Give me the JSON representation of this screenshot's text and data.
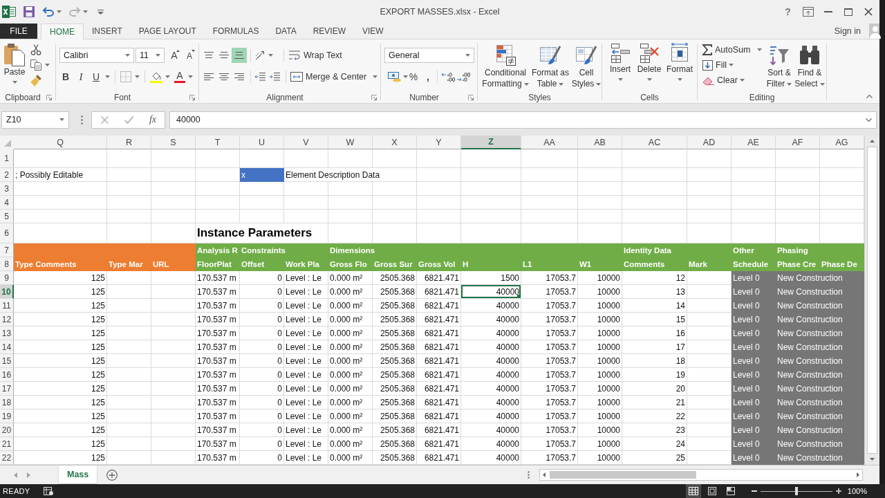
{
  "window": {
    "title": "EXPORT MASSES.xlsx - Excel",
    "help": "?",
    "account": "Sign in"
  },
  "ribbon_tabs": [
    {
      "label": "FILE",
      "kind": "file",
      "selected": false
    },
    {
      "label": "HOME",
      "kind": "tab",
      "selected": true
    },
    {
      "label": "INSERT",
      "kind": "tab",
      "selected": false
    },
    {
      "label": "PAGE LAYOUT",
      "kind": "tab",
      "selected": false
    },
    {
      "label": "FORMULAS",
      "kind": "tab",
      "selected": false
    },
    {
      "label": "DATA",
      "kind": "tab",
      "selected": false
    },
    {
      "label": "REVIEW",
      "kind": "tab",
      "selected": false
    },
    {
      "label": "VIEW",
      "kind": "tab",
      "selected": false
    }
  ],
  "ribbon": {
    "clipboard": {
      "label": "Clipboard",
      "paste": "Paste"
    },
    "font": {
      "label": "Font",
      "name": "Calibri",
      "size": "11",
      "grow": "A",
      "shrink": "A",
      "bold": "B",
      "italic": "I",
      "underline": "U",
      "font_color": "A"
    },
    "alignment": {
      "label": "Alignment",
      "vertical": [
        {
          "kind": "top",
          "selected": false
        },
        {
          "kind": "middle",
          "selected": false
        },
        {
          "kind": "bottom",
          "selected": true
        }
      ],
      "wrap_text": "Wrap Text",
      "merge": "Merge & Center"
    },
    "number": {
      "label": "Number",
      "format": "General",
      "percent": "%",
      "comma": ","
    },
    "styles": {
      "label": "Styles",
      "buttons": [
        {
          "kind": "conditional",
          "label": "Conditional Formatting"
        },
        {
          "kind": "table",
          "label": "Format as Table"
        },
        {
          "kind": "cell_styles",
          "label": "Cell Styles"
        }
      ]
    },
    "cells": {
      "label": "Cells",
      "buttons": [
        {
          "kind": "insert",
          "label": "Insert"
        },
        {
          "kind": "delete",
          "label": "Delete"
        },
        {
          "kind": "format",
          "label": "Format"
        }
      ]
    },
    "editing": {
      "label": "Editing",
      "small": [
        {
          "kind": "autosum",
          "label": "AutoSum"
        },
        {
          "kind": "fill",
          "label": "Fill"
        },
        {
          "kind": "clear",
          "label": "Clear"
        }
      ],
      "large": [
        {
          "kind": "sort",
          "label": "Sort & Filter"
        },
        {
          "kind": "find",
          "label": "Find & Select"
        }
      ]
    }
  },
  "formula_bar": {
    "name_box": "Z10",
    "function": "fx",
    "value": "40000"
  },
  "sheet": {
    "columns": [
      {
        "label": "Q",
        "selected": false
      },
      {
        "label": "R",
        "selected": false
      },
      {
        "label": "S",
        "selected": false
      },
      {
        "label": "T",
        "selected": false
      },
      {
        "label": "U",
        "selected": false
      },
      {
        "label": "V",
        "selected": false
      },
      {
        "label": "W",
        "selected": false
      },
      {
        "label": "X",
        "selected": false
      },
      {
        "label": "Y",
        "selected": false
      },
      {
        "label": "Z",
        "selected": true
      },
      {
        "label": "AA",
        "selected": false
      },
      {
        "label": "AB",
        "selected": false
      },
      {
        "label": "AC",
        "selected": false
      },
      {
        "label": "AD",
        "selected": false
      },
      {
        "label": "AE",
        "selected": false
      },
      {
        "label": "AF",
        "selected": false
      },
      {
        "label": "AG",
        "selected": false
      }
    ],
    "rows": [
      {
        "number": "1",
        "selected": false,
        "kind": "blank"
      },
      {
        "number": "2",
        "selected": false,
        "kind": "note",
        "cells": [
          "; Possibly Editable",
          null,
          null,
          null,
          {
            "text": "x",
            "color": "#4472c4"
          },
          "Element Description Data"
        ]
      },
      {
        "number": "3",
        "selected": false,
        "kind": "blank"
      },
      {
        "number": "4",
        "selected": false,
        "kind": "blank"
      },
      {
        "number": "5",
        "selected": false,
        "kind": "blank"
      },
      {
        "number": "6",
        "selected": false,
        "kind": "title",
        "cells": [
          null,
          null,
          null,
          "Instance Parameters"
        ]
      },
      {
        "number": "7",
        "selected": false,
        "kind": "group_header",
        "cells": [
          {
            "color": "#ed7d31"
          },
          {
            "color": "#ed7d31"
          },
          {
            "color": "#ed7d31"
          },
          {
            "text": "Analysis R",
            "color": "#70ad47"
          },
          {
            "text": "Constraints",
            "color": "#70ad47"
          },
          {
            "color": "#70ad47"
          },
          {
            "text": "Dimensions",
            "color": "#70ad47"
          },
          {
            "color": "#70ad47"
          },
          {
            "color": "#70ad47"
          },
          {
            "color": "#70ad47"
          },
          {
            "color": "#70ad47"
          },
          {
            "color": "#70ad47"
          },
          {
            "text": "Identity Data",
            "color": "#70ad47"
          },
          {
            "color": "#70ad47"
          },
          {
            "text": "Other",
            "color": "#70ad47"
          },
          {
            "text": "Phasing",
            "color": "#70ad47"
          },
          {
            "color": "#70ad47"
          }
        ]
      },
      {
        "number": "8",
        "selected": false,
        "kind": "field_header",
        "cells": [
          {
            "text": "Type Comments",
            "color": "#ed7d31"
          },
          {
            "text": "Type Mar",
            "color": "#ed7d31"
          },
          {
            "text": "URL",
            "color": "#ed7d31"
          },
          {
            "text": "FloorPlat",
            "color": "#70ad47"
          },
          {
            "text": "Offset",
            "color": "#70ad47"
          },
          {
            "text": "Work Pla",
            "color": "#70ad47"
          },
          {
            "text": "Gross Flo",
            "color": "#70ad47"
          },
          {
            "text": "Gross Sur",
            "color": "#70ad47"
          },
          {
            "text": "Gross Vol",
            "color": "#70ad47"
          },
          {
            "text": "H",
            "color": "#70ad47"
          },
          {
            "text": "L1",
            "color": "#70ad47"
          },
          {
            "text": "W1",
            "color": "#70ad47"
          },
          {
            "text": "Comments",
            "color": "#70ad47"
          },
          {
            "text": "Mark",
            "color": "#70ad47"
          },
          {
            "text": "Schedule",
            "color": "#70ad47"
          },
          {
            "text": "Phase Cre",
            "color": "#70ad47"
          },
          {
            "text": "Phase De",
            "color": "#70ad47"
          }
        ]
      },
      {
        "number": "9",
        "selected": false,
        "kind": "data",
        "cells": [
          "125",
          null,
          null,
          "170.537 m",
          "0",
          "Level : Le",
          "0.000 m²",
          "2505.368",
          "6821.471",
          "1500",
          "17053.7",
          "10000",
          "12",
          null,
          {
            "text": "Level 0",
            "color": "#767676"
          },
          {
            "text": "New Construction",
            "color": "#767676"
          },
          {
            "color": "#767676"
          }
        ]
      },
      {
        "number": "10",
        "selected": true,
        "kind": "data",
        "cells": [
          "125",
          null,
          null,
          "170.537 m",
          "0",
          "Level : Le",
          "0.000 m²",
          "2505.368",
          "6821.471",
          "40000",
          "17053.7",
          "10000",
          "13",
          null,
          {
            "text": "Level 0",
            "color": "#767676"
          },
          {
            "text": "New Construction",
            "color": "#767676"
          },
          {
            "color": "#767676"
          }
        ]
      },
      {
        "number": "11",
        "selected": false,
        "kind": "data",
        "cells": [
          "125",
          null,
          null,
          "170.537 m",
          "0",
          "Level : Le",
          "0.000 m²",
          "2505.368",
          "6821.471",
          "40000",
          "17053.7",
          "10000",
          "14",
          null,
          {
            "text": "Level 0",
            "color": "#767676"
          },
          {
            "text": "New Construction",
            "color": "#767676"
          },
          {
            "color": "#767676"
          }
        ]
      },
      {
        "number": "12",
        "selected": false,
        "kind": "data",
        "cells": [
          "125",
          null,
          null,
          "170.537 m",
          "0",
          "Level : Le",
          "0.000 m²",
          "2505.368",
          "6821.471",
          "40000",
          "17053.7",
          "10000",
          "15",
          null,
          {
            "text": "Level 0",
            "color": "#767676"
          },
          {
            "text": "New Construction",
            "color": "#767676"
          },
          {
            "color": "#767676"
          }
        ]
      },
      {
        "number": "13",
        "selected": false,
        "kind": "data",
        "cells": [
          "125",
          null,
          null,
          "170.537 m",
          "0",
          "Level : Le",
          "0.000 m²",
          "2505.368",
          "6821.471",
          "40000",
          "17053.7",
          "10000",
          "16",
          null,
          {
            "text": "Level 0",
            "color": "#767676"
          },
          {
            "text": "New Construction",
            "color": "#767676"
          },
          {
            "color": "#767676"
          }
        ]
      },
      {
        "number": "14",
        "selected": false,
        "kind": "data",
        "cells": [
          "125",
          null,
          null,
          "170.537 m",
          "0",
          "Level : Le",
          "0.000 m²",
          "2505.368",
          "6821.471",
          "40000",
          "17053.7",
          "10000",
          "17",
          null,
          {
            "text": "Level 0",
            "color": "#767676"
          },
          {
            "text": "New Construction",
            "color": "#767676"
          },
          {
            "color": "#767676"
          }
        ]
      },
      {
        "number": "15",
        "selected": false,
        "kind": "data",
        "cells": [
          "125",
          null,
          null,
          "170.537 m",
          "0",
          "Level : Le",
          "0.000 m²",
          "2505.368",
          "6821.471",
          "40000",
          "17053.7",
          "10000",
          "18",
          null,
          {
            "text": "Level 0",
            "color": "#767676"
          },
          {
            "text": "New Construction",
            "color": "#767676"
          },
          {
            "color": "#767676"
          }
        ]
      },
      {
        "number": "16",
        "selected": false,
        "kind": "data",
        "cells": [
          "125",
          null,
          null,
          "170.537 m",
          "0",
          "Level : Le",
          "0.000 m²",
          "2505.368",
          "6821.471",
          "40000",
          "17053.7",
          "10000",
          "19",
          null,
          {
            "text": "Level 0",
            "color": "#767676"
          },
          {
            "text": "New Construction",
            "color": "#767676"
          },
          {
            "color": "#767676"
          }
        ]
      },
      {
        "number": "17",
        "selected": false,
        "kind": "data",
        "cells": [
          "125",
          null,
          null,
          "170.537 m",
          "0",
          "Level : Le",
          "0.000 m²",
          "2505.368",
          "6821.471",
          "40000",
          "17053.7",
          "10000",
          "20",
          null,
          {
            "text": "Level 0",
            "color": "#767676"
          },
          {
            "text": "New Construction",
            "color": "#767676"
          },
          {
            "color": "#767676"
          }
        ]
      },
      {
        "number": "18",
        "selected": false,
        "kind": "data",
        "cells": [
          "125",
          null,
          null,
          "170.537 m",
          "0",
          "Level : Le",
          "0.000 m²",
          "2505.368",
          "6821.471",
          "40000",
          "17053.7",
          "10000",
          "21",
          null,
          {
            "text": "Level 0",
            "color": "#767676"
          },
          {
            "text": "New Construction",
            "color": "#767676"
          },
          {
            "color": "#767676"
          }
        ]
      },
      {
        "number": "19",
        "selected": false,
        "kind": "data",
        "cells": [
          "125",
          null,
          null,
          "170.537 m",
          "0",
          "Level : Le",
          "0.000 m²",
          "2505.368",
          "6821.471",
          "40000",
          "17053.7",
          "10000",
          "22",
          null,
          {
            "text": "Level 0",
            "color": "#767676"
          },
          {
            "text": "New Construction",
            "color": "#767676"
          },
          {
            "color": "#767676"
          }
        ]
      },
      {
        "number": "20",
        "selected": false,
        "kind": "data",
        "cells": [
          "125",
          null,
          null,
          "170.537 m",
          "0",
          "Level : Le",
          "0.000 m²",
          "2505.368",
          "6821.471",
          "40000",
          "17053.7",
          "10000",
          "23",
          null,
          {
            "text": "Level 0",
            "color": "#767676"
          },
          {
            "text": "New Construction",
            "color": "#767676"
          },
          {
            "color": "#767676"
          }
        ]
      },
      {
        "number": "21",
        "selected": false,
        "kind": "data",
        "cells": [
          "125",
          null,
          null,
          "170.537 m",
          "0",
          "Level : Le",
          "0.000 m²",
          "2505.368",
          "6821.471",
          "40000",
          "17053.7",
          "10000",
          "24",
          null,
          {
            "text": "Level 0",
            "color": "#767676"
          },
          {
            "text": "New Construction",
            "color": "#767676"
          },
          {
            "color": "#767676"
          }
        ]
      },
      {
        "number": "22",
        "selected": false,
        "kind": "data",
        "cells": [
          "125",
          null,
          null,
          "170.537 m",
          "0",
          "Level : Le",
          "0.000 m²",
          "2505.368",
          "6821.471",
          "40000",
          "17053.7",
          "10000",
          "25",
          null,
          {
            "text": "Level 0",
            "color": "#767676"
          },
          {
            "text": "New Construction",
            "color": "#767676"
          },
          {
            "color": "#767676"
          }
        ]
      }
    ]
  },
  "sheet_tabs": [
    {
      "label": "Mass",
      "selected": true
    }
  ],
  "status_bar": {
    "mode": "READY",
    "views": [
      {
        "kind": "normal",
        "selected": true
      },
      {
        "kind": "page_layout",
        "selected": false
      },
      {
        "kind": "page_break",
        "selected": false
      }
    ],
    "zoom": {
      "level": 0.5,
      "reading": "100%"
    }
  }
}
